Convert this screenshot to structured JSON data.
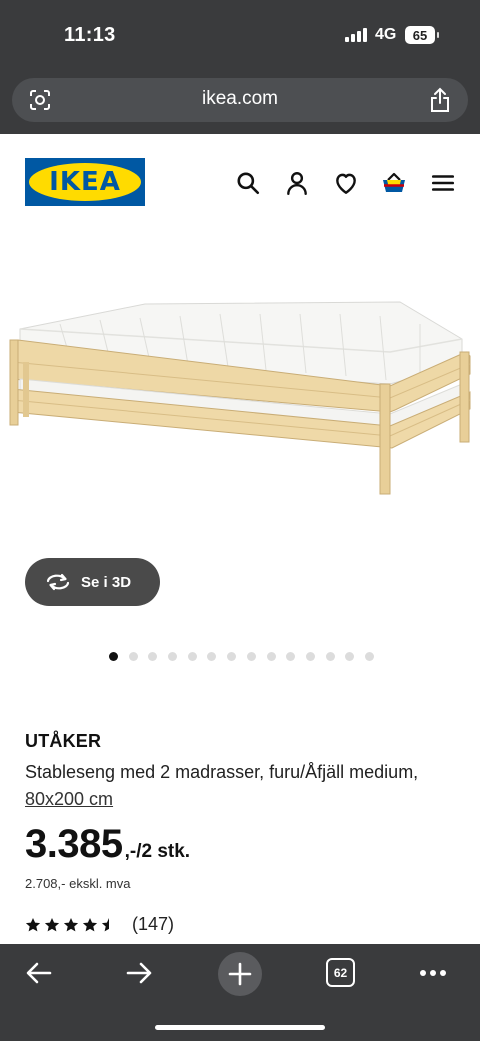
{
  "status_bar": {
    "time": "11:13",
    "network": "4G",
    "battery": "65"
  },
  "browser": {
    "url": "ikea.com"
  },
  "header": {
    "logo_text": "IKEA",
    "icons": [
      "search-icon",
      "user-icon",
      "heart-icon",
      "basket-icon",
      "menu-icon"
    ]
  },
  "gallery": {
    "view_3d_label": "Se i 3D",
    "dot_count": 14,
    "active_dot": 0
  },
  "product": {
    "name": "UTÅKER",
    "description": "Stableseng med 2 madrasser, furu/Åfjäll medium,",
    "size_link": "80x200 cm",
    "price_main": "3.385",
    "price_suffix": ",-/2 stk.",
    "price_ex_vat": "2.708,- ekskl. mva",
    "rating": 4.5,
    "rating_max": 5,
    "review_count": "(147)"
  },
  "bottom_bar": {
    "tabs_count": "62"
  },
  "colors": {
    "chrome": "#3a3b3d",
    "ikea_blue": "#0058a3",
    "ikea_yellow": "#ffdb00"
  }
}
